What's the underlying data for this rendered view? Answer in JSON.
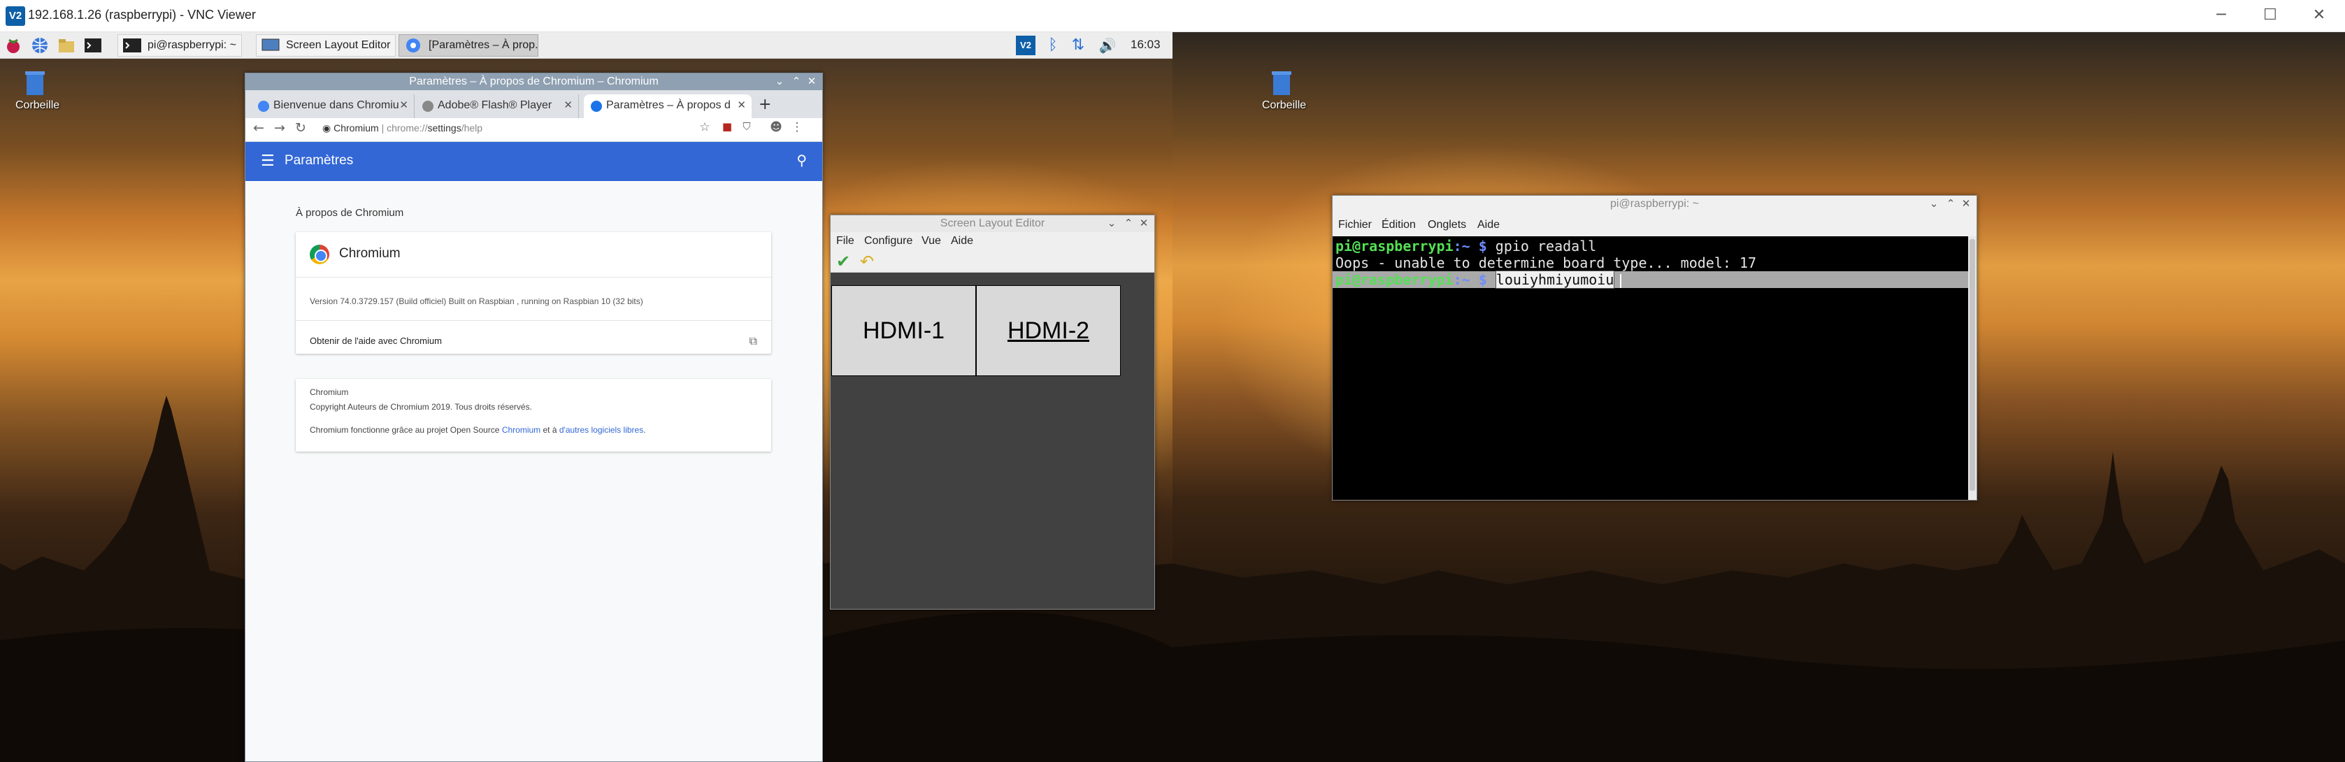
{
  "vnc": {
    "icon_text": "V2",
    "title": "192.168.1.26 (raspberrypi) - VNC Viewer"
  },
  "panel": {
    "taskbar": [
      {
        "label": "pi@raspberrypi: ~"
      },
      {
        "label": "Screen Layout Editor"
      },
      {
        "label": "[Paramètres – À prop..."
      }
    ],
    "tray_icon_vnc": "V2",
    "clock": "16:03"
  },
  "desktop": {
    "trash_label_left": "Corbeille",
    "trash_label_right": "Corbeille"
  },
  "chromium": {
    "window_title": "Paramètres – À propos de Chromium – Chromium",
    "tabs": [
      {
        "label": "Bienvenue dans Chromiu"
      },
      {
        "label": "Adobe® Flash® Player"
      },
      {
        "label": "Paramètres – À propos d"
      }
    ],
    "new_tab": "+",
    "url_origin": "Chromium",
    "url_sep": " | ",
    "url_scheme": "chrome://",
    "url_path": "settings",
    "url_rest": "/help",
    "settings_title": "Paramètres",
    "about_heading": "À propos de Chromium",
    "product_name": "Chromium",
    "version": "Version 74.0.3729.157 (Build officiel) Built on Raspbian , running on Raspbian 10 (32 bits)",
    "help_link": "Obtenir de l'aide avec Chromium",
    "legal_name": "Chromium",
    "copyright": "Copyright Auteurs de Chromium 2019. Tous droits réservés.",
    "oss_prefix": "Chromium fonctionne grâce au projet Open Source ",
    "oss_link1": "Chromium",
    "oss_mid": " et à ",
    "oss_link2": "d'autres logiciels libres",
    "oss_suffix": "."
  },
  "layout_editor": {
    "window_title": "Screen Layout Editor",
    "menu": [
      "File",
      "Configure",
      "Vue",
      "Aide"
    ],
    "monitors": [
      {
        "label": "HDMI-1"
      },
      {
        "label": "HDMI-2"
      }
    ]
  },
  "terminal": {
    "window_title": "pi@raspberrypi: ~",
    "menu": [
      "Fichier",
      "Édition",
      "Onglets",
      "Aide"
    ],
    "lines": [
      {
        "user": "pi@raspberrypi",
        "dir": ":~ $ ",
        "cmd": "gpio readall"
      },
      {
        "output": "Oops - unable to determine board type... model: 17"
      },
      {
        "user": "pi@raspberrypi",
        "dir": ":~ $ ",
        "cmd": "louiyhmiyumoiu"
      }
    ]
  }
}
